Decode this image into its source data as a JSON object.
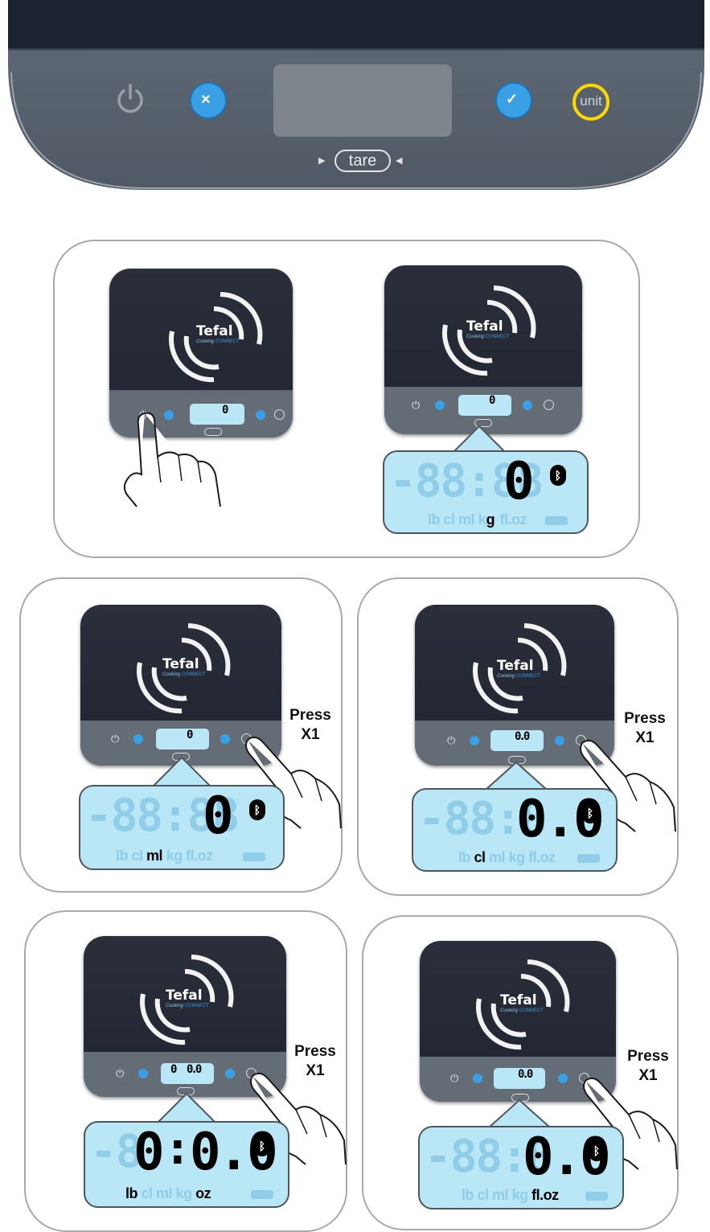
{
  "top_panel": {
    "power_icon": "power-icon",
    "cancel_icon": "close-icon",
    "confirm_icon": "check-icon",
    "unit_label": "unit",
    "tare_label": "tare",
    "highlight_color": "#ffd600",
    "button_color": "#3aa0e6"
  },
  "brand": {
    "name": "Tefal",
    "tagline_a": "Cooking",
    "tagline_b": "CONNECT"
  },
  "unit_row": [
    "lb",
    "cl",
    "ml",
    "kg",
    "fl.oz"
  ],
  "press_label": "Press\nX1",
  "steps": [
    {
      "reading": "0",
      "unit": "g"
    },
    {
      "reading": "0",
      "unit": "ml"
    },
    {
      "reading": "0.0",
      "unit": "cl"
    },
    {
      "reading_lb": "0",
      "reading_oz": "0.0",
      "unit_a": "lb",
      "unit_b": "oz"
    },
    {
      "reading": "0.0",
      "unit": "fl.oz"
    }
  ]
}
